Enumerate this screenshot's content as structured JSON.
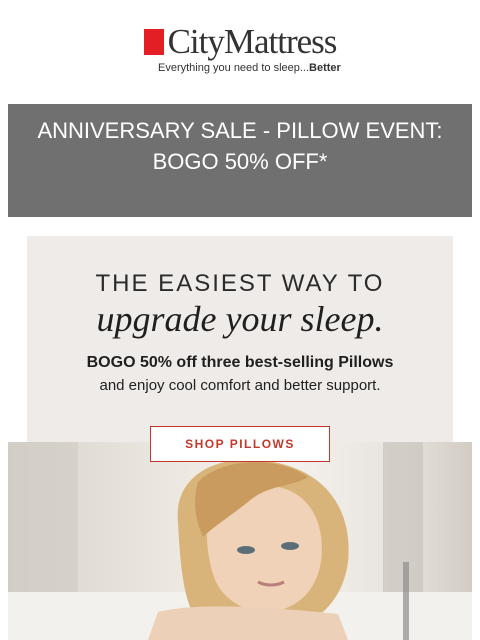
{
  "logo": {
    "name": "CityMattress",
    "tagline": "Everything you need to sleep...",
    "tagline_bold": "Better",
    "accent": "#e31e24"
  },
  "banner": {
    "line1": "ANNIVERSARY SALE - PILLOW EVENT:",
    "line2": "BOGO 50% OFF*",
    "background": "#707070"
  },
  "promo": {
    "headline": "THE EASIEST WAY TO",
    "script": "upgrade your sleep.",
    "bold_line": "BOGO 50% off three best-selling Pillows",
    "sub_line": "and enjoy cool comfort and better support.",
    "cta": "SHOP PILLOWS",
    "cta_color": "#c0392b"
  }
}
